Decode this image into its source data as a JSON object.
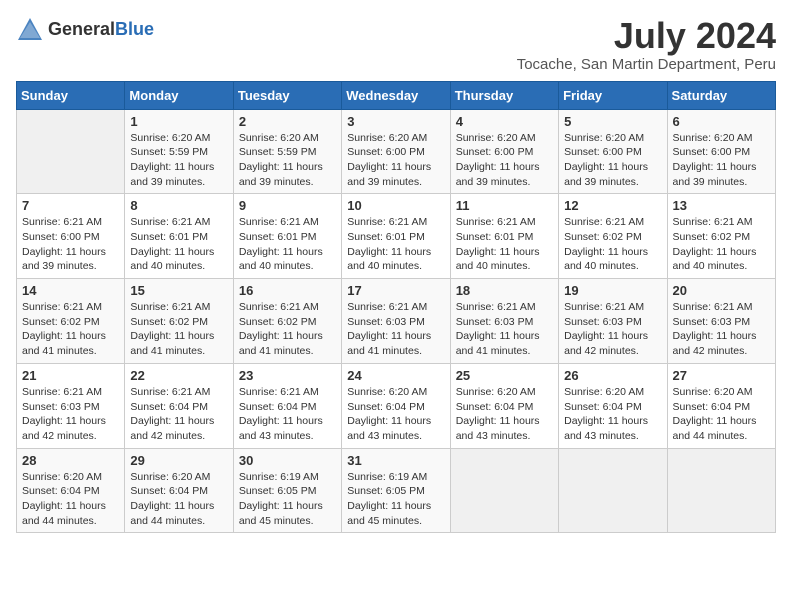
{
  "logo": {
    "general": "General",
    "blue": "Blue"
  },
  "title": {
    "month_year": "July 2024",
    "location": "Tocache, San Martin Department, Peru"
  },
  "days_header": [
    "Sunday",
    "Monday",
    "Tuesday",
    "Wednesday",
    "Thursday",
    "Friday",
    "Saturday"
  ],
  "weeks": [
    [
      {
        "day": "",
        "info": ""
      },
      {
        "day": "1",
        "info": "Sunrise: 6:20 AM\nSunset: 5:59 PM\nDaylight: 11 hours\nand 39 minutes."
      },
      {
        "day": "2",
        "info": "Sunrise: 6:20 AM\nSunset: 5:59 PM\nDaylight: 11 hours\nand 39 minutes."
      },
      {
        "day": "3",
        "info": "Sunrise: 6:20 AM\nSunset: 6:00 PM\nDaylight: 11 hours\nand 39 minutes."
      },
      {
        "day": "4",
        "info": "Sunrise: 6:20 AM\nSunset: 6:00 PM\nDaylight: 11 hours\nand 39 minutes."
      },
      {
        "day": "5",
        "info": "Sunrise: 6:20 AM\nSunset: 6:00 PM\nDaylight: 11 hours\nand 39 minutes."
      },
      {
        "day": "6",
        "info": "Sunrise: 6:20 AM\nSunset: 6:00 PM\nDaylight: 11 hours\nand 39 minutes."
      }
    ],
    [
      {
        "day": "7",
        "info": "Sunrise: 6:21 AM\nSunset: 6:00 PM\nDaylight: 11 hours\nand 39 minutes."
      },
      {
        "day": "8",
        "info": "Sunrise: 6:21 AM\nSunset: 6:01 PM\nDaylight: 11 hours\nand 40 minutes."
      },
      {
        "day": "9",
        "info": "Sunrise: 6:21 AM\nSunset: 6:01 PM\nDaylight: 11 hours\nand 40 minutes."
      },
      {
        "day": "10",
        "info": "Sunrise: 6:21 AM\nSunset: 6:01 PM\nDaylight: 11 hours\nand 40 minutes."
      },
      {
        "day": "11",
        "info": "Sunrise: 6:21 AM\nSunset: 6:01 PM\nDaylight: 11 hours\nand 40 minutes."
      },
      {
        "day": "12",
        "info": "Sunrise: 6:21 AM\nSunset: 6:02 PM\nDaylight: 11 hours\nand 40 minutes."
      },
      {
        "day": "13",
        "info": "Sunrise: 6:21 AM\nSunset: 6:02 PM\nDaylight: 11 hours\nand 40 minutes."
      }
    ],
    [
      {
        "day": "14",
        "info": "Sunrise: 6:21 AM\nSunset: 6:02 PM\nDaylight: 11 hours\nand 41 minutes."
      },
      {
        "day": "15",
        "info": "Sunrise: 6:21 AM\nSunset: 6:02 PM\nDaylight: 11 hours\nand 41 minutes."
      },
      {
        "day": "16",
        "info": "Sunrise: 6:21 AM\nSunset: 6:02 PM\nDaylight: 11 hours\nand 41 minutes."
      },
      {
        "day": "17",
        "info": "Sunrise: 6:21 AM\nSunset: 6:03 PM\nDaylight: 11 hours\nand 41 minutes."
      },
      {
        "day": "18",
        "info": "Sunrise: 6:21 AM\nSunset: 6:03 PM\nDaylight: 11 hours\nand 41 minutes."
      },
      {
        "day": "19",
        "info": "Sunrise: 6:21 AM\nSunset: 6:03 PM\nDaylight: 11 hours\nand 42 minutes."
      },
      {
        "day": "20",
        "info": "Sunrise: 6:21 AM\nSunset: 6:03 PM\nDaylight: 11 hours\nand 42 minutes."
      }
    ],
    [
      {
        "day": "21",
        "info": "Sunrise: 6:21 AM\nSunset: 6:03 PM\nDaylight: 11 hours\nand 42 minutes."
      },
      {
        "day": "22",
        "info": "Sunrise: 6:21 AM\nSunset: 6:04 PM\nDaylight: 11 hours\nand 42 minutes."
      },
      {
        "day": "23",
        "info": "Sunrise: 6:21 AM\nSunset: 6:04 PM\nDaylight: 11 hours\nand 43 minutes."
      },
      {
        "day": "24",
        "info": "Sunrise: 6:20 AM\nSunset: 6:04 PM\nDaylight: 11 hours\nand 43 minutes."
      },
      {
        "day": "25",
        "info": "Sunrise: 6:20 AM\nSunset: 6:04 PM\nDaylight: 11 hours\nand 43 minutes."
      },
      {
        "day": "26",
        "info": "Sunrise: 6:20 AM\nSunset: 6:04 PM\nDaylight: 11 hours\nand 43 minutes."
      },
      {
        "day": "27",
        "info": "Sunrise: 6:20 AM\nSunset: 6:04 PM\nDaylight: 11 hours\nand 44 minutes."
      }
    ],
    [
      {
        "day": "28",
        "info": "Sunrise: 6:20 AM\nSunset: 6:04 PM\nDaylight: 11 hours\nand 44 minutes."
      },
      {
        "day": "29",
        "info": "Sunrise: 6:20 AM\nSunset: 6:04 PM\nDaylight: 11 hours\nand 44 minutes."
      },
      {
        "day": "30",
        "info": "Sunrise: 6:19 AM\nSunset: 6:05 PM\nDaylight: 11 hours\nand 45 minutes."
      },
      {
        "day": "31",
        "info": "Sunrise: 6:19 AM\nSunset: 6:05 PM\nDaylight: 11 hours\nand 45 minutes."
      },
      {
        "day": "",
        "info": ""
      },
      {
        "day": "",
        "info": ""
      },
      {
        "day": "",
        "info": ""
      }
    ]
  ]
}
